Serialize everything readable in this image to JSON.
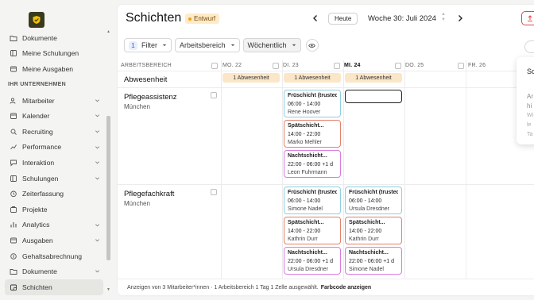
{
  "sidebar": {
    "items_top": [
      {
        "label": "Dokumente",
        "icon": "folder-icon"
      },
      {
        "label": "Meine Schulungen",
        "icon": "book-icon"
      },
      {
        "label": "Meine Ausgaben",
        "icon": "receipt-icon"
      }
    ],
    "section_label": "IHR UNTERNEHMEN",
    "items": [
      {
        "label": "Mitarbeiter",
        "icon": "users-icon",
        "chevron": true
      },
      {
        "label": "Kalender",
        "icon": "calendar-icon",
        "chevron": true
      },
      {
        "label": "Recruiting",
        "icon": "recruiting-icon",
        "chevron": true
      },
      {
        "label": "Performance",
        "icon": "chart-icon",
        "chevron": true
      },
      {
        "label": "Interaktion",
        "icon": "chat-icon",
        "chevron": true
      },
      {
        "label": "Schulungen",
        "icon": "book-icon",
        "chevron": true
      },
      {
        "label": "Zeiterfassung",
        "icon": "clock-icon",
        "chevron": false
      },
      {
        "label": "Projekte",
        "icon": "projects-icon",
        "chevron": false
      },
      {
        "label": "Analytics",
        "icon": "analytics-icon",
        "chevron": true
      },
      {
        "label": "Ausgaben",
        "icon": "receipt-icon",
        "chevron": true
      },
      {
        "label": "Gehaltsabrechnung",
        "icon": "payroll-icon",
        "chevron": false
      },
      {
        "label": "Dokumente",
        "icon": "folder-icon",
        "chevron": true
      },
      {
        "label": "Schichten",
        "icon": "shifts-icon",
        "chevron": false,
        "active": true
      }
    ]
  },
  "header": {
    "title": "Schichten",
    "status_badge": "Entwurf",
    "today_label": "Heute",
    "week_label": "Woche 30: Juli 2024"
  },
  "toolbar": {
    "filter_count": "1",
    "filter_label": "Filter",
    "area_label": "Arbeitsbereich",
    "view_label": "Wöchentlich"
  },
  "grid": {
    "area_header": "ARBEITSBEREICH",
    "days": [
      {
        "label": "MO. 22",
        "today": false
      },
      {
        "label": "DI. 23",
        "today": false
      },
      {
        "label": "MI. 24",
        "today": true
      },
      {
        "label": "DO. 25",
        "today": false
      },
      {
        "label": "FR. 26",
        "today": false
      }
    ],
    "absence_label": "Abwesenheit",
    "absence_pills": [
      "1 Abwesenheit",
      "1 Abwesenheit",
      "1 Abwesenheit"
    ],
    "rows": [
      {
        "name": "Pflegeassistenz",
        "location": "München",
        "shifts_tue": [
          {
            "type": "early",
            "name": "Früschicht (trusted)",
            "time": "06:00 - 14:00",
            "person": "Rene Hoover"
          },
          {
            "type": "late",
            "name": "Spätschicht...",
            "time": "14:00 - 22:00",
            "person": "Marko Mehler"
          },
          {
            "type": "night",
            "name": "Nachtschicht...",
            "time": "22:00 - 06:00 +1 d",
            "person": "Leon Fuhrmann"
          }
        ]
      },
      {
        "name": "Pflegefachkraft",
        "location": "München",
        "shifts_tue": [
          {
            "type": "early",
            "name": "Früschicht (trusted)",
            "time": "06:00 - 14:00",
            "person": "Simone Nadel"
          },
          {
            "type": "late",
            "name": "Spätschicht...",
            "time": "14:00 - 22:00",
            "person": "Kathrin Durr"
          },
          {
            "type": "night",
            "name": "Nachtschicht...",
            "time": "22:00 - 06:00 +1 d",
            "person": "Ursula Dresdner"
          }
        ],
        "shifts_wed": [
          {
            "type": "early",
            "name": "Früschicht (trusted)",
            "time": "06:00 - 14:00",
            "person": "Ursula Dresdner"
          },
          {
            "type": "late",
            "name": "Spätschicht...",
            "time": "14:00 - 22:00",
            "person": "Kathrin Durr"
          },
          {
            "type": "night",
            "name": "Nachtschicht...",
            "time": "22:00 - 06:00 +1 d",
            "person": "Simone Nadel"
          }
        ]
      }
    ]
  },
  "footer": {
    "summary": "Anzeigen von 3 Mitarbeiter*innen · 1 Arbeitsbereich 1 Tag 1 Zelle ausgewählt.",
    "link": "Farbcode anzeigen"
  },
  "popover": {
    "title": "Sc",
    "lines": [
      "Ar",
      "hi",
      "Wi",
      "le",
      "Ta"
    ]
  },
  "colors": {
    "early": "#8ecfe0",
    "late": "#e2826a",
    "night": "#d77be0",
    "absence": "#fbe6c8",
    "draft_badge": "#fdebc9",
    "publish": "#e04848"
  }
}
